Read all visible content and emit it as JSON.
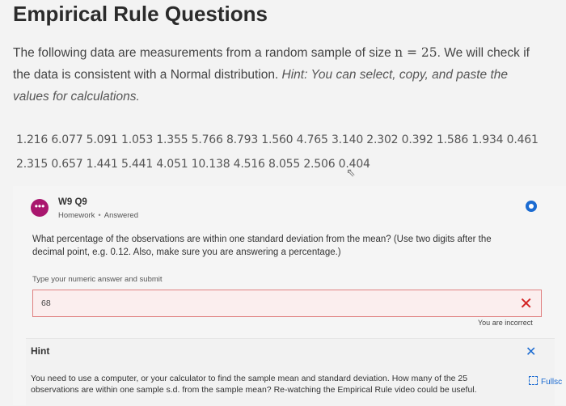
{
  "page": {
    "title": "Empirical Rule Questions",
    "intro_part1": "The following data are measurements from a random sample of size ",
    "n_math": "n = 25",
    "intro_part2": ". We will check if the data is consistent with a Normal distribution. ",
    "hint_inline": "Hint: You can select, copy, and paste the values for calculations.",
    "data_values": "1.216 6.077 5.091 1.053 1.355 5.766 8.793 1.560 4.765 3.140 2.302 0.392 1.586 1.934 0.461 2.315 0.657 1.441 5.441 4.051 10.138 4.516 8.055 2.506 0.404"
  },
  "question": {
    "avatar_glyph": "•••",
    "title": "W9 Q9",
    "type": "Homework",
    "status": "Answered",
    "text": "What percentage of the observations are within one standard deviation from the mean? (Use two digits after the decimal point, e.g. 0.12. Also, make sure you are answering a percentage.)",
    "answer_label": "Type your numeric answer and submit",
    "answer_value": "68",
    "feedback": "You are incorrect",
    "wrong_icon": "✕"
  },
  "hint": {
    "title": "Hint",
    "close_icon": "✕",
    "text": "You need to use a computer, or your calculator to find the sample mean and standard deviation. How many of the 25 observations are within one sample s.d. from the sample mean? Re-watching the Empirical Rule video could be useful."
  },
  "fullscreen": {
    "label": "Fullsc"
  }
}
